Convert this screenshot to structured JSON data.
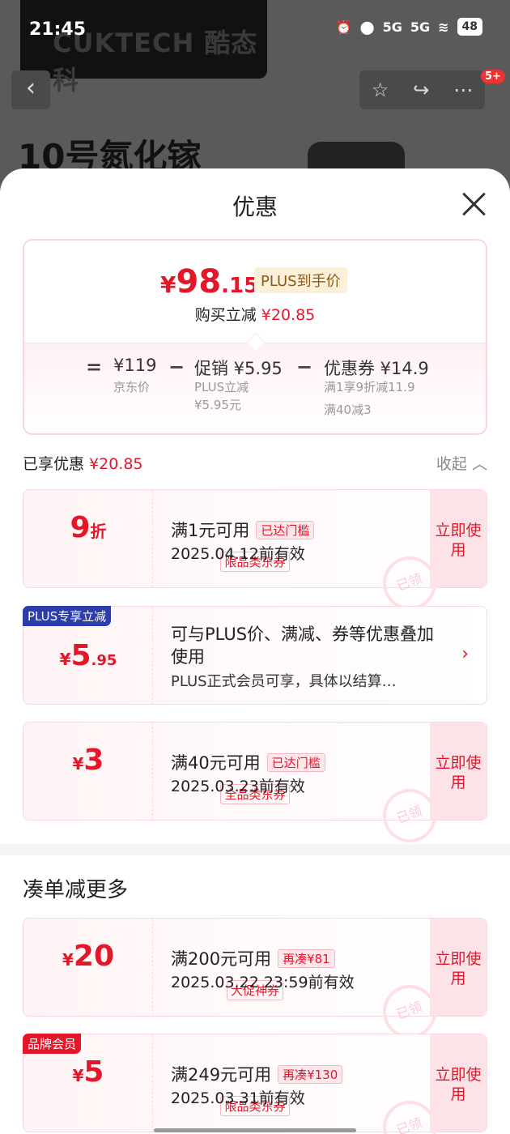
{
  "status": {
    "time": "21:45",
    "battery": "48",
    "signal1": "5G",
    "signal2": "5G"
  },
  "background": {
    "brand": "CUKTECH 酷态科",
    "title": "10号氮化镓",
    "badge": "5+"
  },
  "sheet": {
    "title": "优惠"
  },
  "price": {
    "currency": "¥",
    "int": "98",
    "dec": ".15",
    "plus_tag": "PLUS到手价",
    "reduce_label": "购买立减",
    "reduce_value": "¥20.85",
    "calc": {
      "eq": "=",
      "minus": "−",
      "jd_price": "¥119",
      "jd_label": "京东价",
      "promo": "促销 ¥5.95",
      "promo_sub1": "PLUS立减",
      "promo_sub2": "¥5.95元",
      "coupon": "优惠券 ¥14.9",
      "coupon_sub1": "满1享9折减11.9",
      "coupon_sub2": "满40减3"
    }
  },
  "enjoyed": {
    "label": "已享优惠",
    "value": "¥20.85",
    "collapse": "收起"
  },
  "coupons": [
    {
      "amt_main": "9",
      "amt_suffix": "折",
      "type": "限品类东券",
      "cond": "满1元可用",
      "tag": "已达门槛",
      "date": "2025.04.12前有效",
      "use": "立即使用",
      "stamp": "已领"
    },
    {
      "corner": "PLUS专享立减",
      "amt_prefix": "¥",
      "amt_main": "5",
      "amt_dec": ".95",
      "desc1": "可与PLUS价、满减、券等优惠叠加使用",
      "desc2": "PLUS正式会员可享，具体以结算…"
    },
    {
      "amt_prefix": "¥",
      "amt_main": "3",
      "type": "全品类东券",
      "cond": "满40元可用",
      "tag": "已达门槛",
      "date": "2025.03.23前有效",
      "use": "立即使用",
      "stamp": "已领"
    }
  ],
  "more": {
    "title": "凑单减更多",
    "coupons": [
      {
        "amt_prefix": "¥",
        "amt_main": "20",
        "type": "大促神券",
        "cond": "满200元可用",
        "tag": "再凑¥81",
        "date": "2025.03.22 23:59前有效",
        "use": "立即使用",
        "stamp": "已领"
      },
      {
        "corner": "品牌会员",
        "amt_prefix": "¥",
        "amt_main": "5",
        "type": "限品类东券",
        "cond": "满249元可用",
        "tag": "再凑¥130",
        "date": "2025.03.31前有效",
        "use": "立即使用",
        "stamp": "已领"
      }
    ]
  },
  "colors": {
    "accent": "#e4172a",
    "plus_blue": "#2c3da8",
    "coupon_bg": "#fde3e7"
  }
}
